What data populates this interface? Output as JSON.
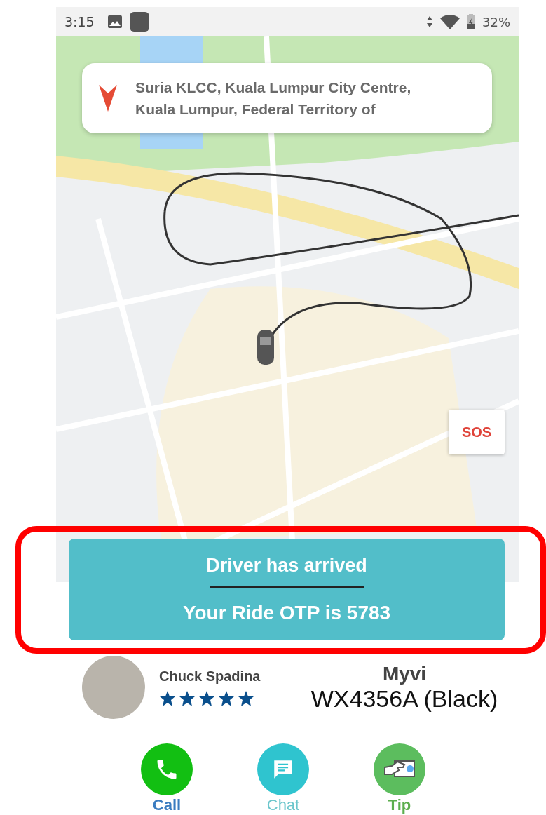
{
  "status_bar": {
    "time": "3:15",
    "battery": "32%"
  },
  "destination": {
    "address": "Suria KLCC, Kuala Lumpur City Centre, Kuala Lumpur, Federal Territory of"
  },
  "sos_button": "SOS",
  "banner": {
    "title": "Driver has arrived",
    "otp": "Your Ride OTP is 5783"
  },
  "driver": {
    "name": "Chuck Spadina",
    "stars": 5
  },
  "vehicle": {
    "model": "Myvi",
    "plate": "WX4356A (Black)"
  },
  "actions": [
    {
      "kind": "call",
      "label": "Call"
    },
    {
      "kind": "chat",
      "label": "Chat"
    },
    {
      "kind": "tip",
      "label": "Tip"
    }
  ]
}
